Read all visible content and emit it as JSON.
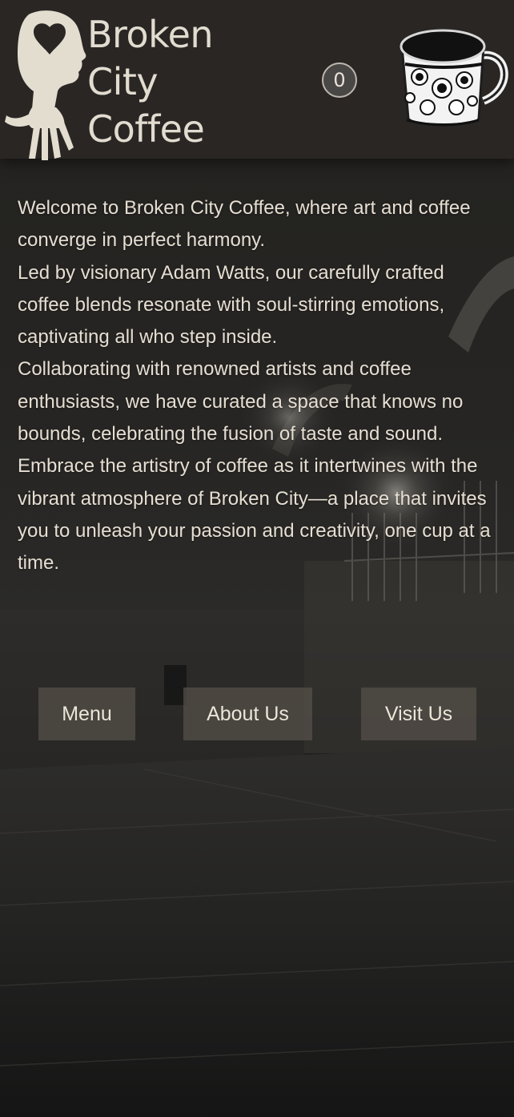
{
  "brand": {
    "line1": "Broken",
    "line2": "City",
    "line3": "Coffee"
  },
  "cart": {
    "count": "0"
  },
  "intro": {
    "paragraphs": [
      "Welcome to Broken City Coffee, where art and coffee converge in perfect harmony.",
      "Led by visionary Adam Watts, our carefully crafted coffee blends resonate with soul-stirring emotions, captivating all who step inside.",
      "Collaborating with renowned artists and coffee enthusiasts, we have curated a space that knows no bounds, celebrating the fusion of taste and sound.",
      "Embrace the artistry of coffee as it intertwines with the vibrant atmosphere of Broken City—a place that invites you to unleash your passion and creativity, one cup at a time."
    ]
  },
  "nav": {
    "menu_label": "Menu",
    "about_label": "About Us",
    "visit_label": "Visit Us"
  },
  "colors": {
    "header_bg": "#2a2624",
    "text": "#e6ded2",
    "button_bg": "#56504a"
  },
  "icons": {
    "logo": "hand-with-heart-logo",
    "cart": "cart-count-badge",
    "mug": "coffee-mug-icon"
  }
}
